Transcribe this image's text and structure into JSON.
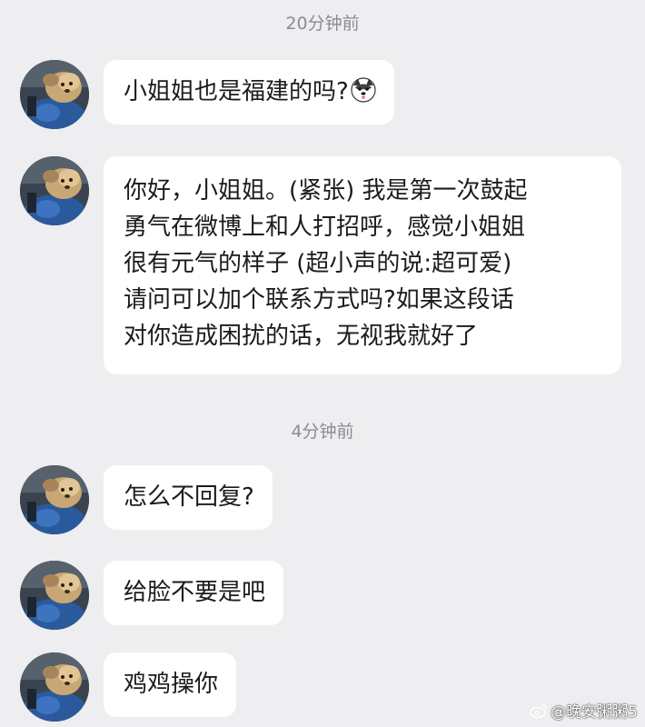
{
  "timestamps": [
    "20分钟前",
    "4分钟前"
  ],
  "messages": [
    {
      "text": "小姐姐也是福建的吗?",
      "emoji": "husky-dog-emoji"
    },
    {
      "lines": [
        "你好，小姐姐。(紧张) 我是第一次鼓起",
        "勇气在微博上和人打招呼，感觉小姐姐",
        "很有元气的样子 (超小声的说:超可爱)",
        "请问可以加个联系方式吗?如果这段话",
        "对你造成困扰的话，无视我就好了"
      ]
    },
    {
      "text": "怎么不回复?"
    },
    {
      "text": "给脸不要是吧"
    },
    {
      "text": "鸡鸡操你"
    }
  ],
  "watermark": {
    "icon": "weibo-icon",
    "text": "@晚安粥粥5"
  },
  "colors": {
    "background": "#eeeef0",
    "bubble": "#ffffff",
    "timestamp": "#8c8c90"
  }
}
